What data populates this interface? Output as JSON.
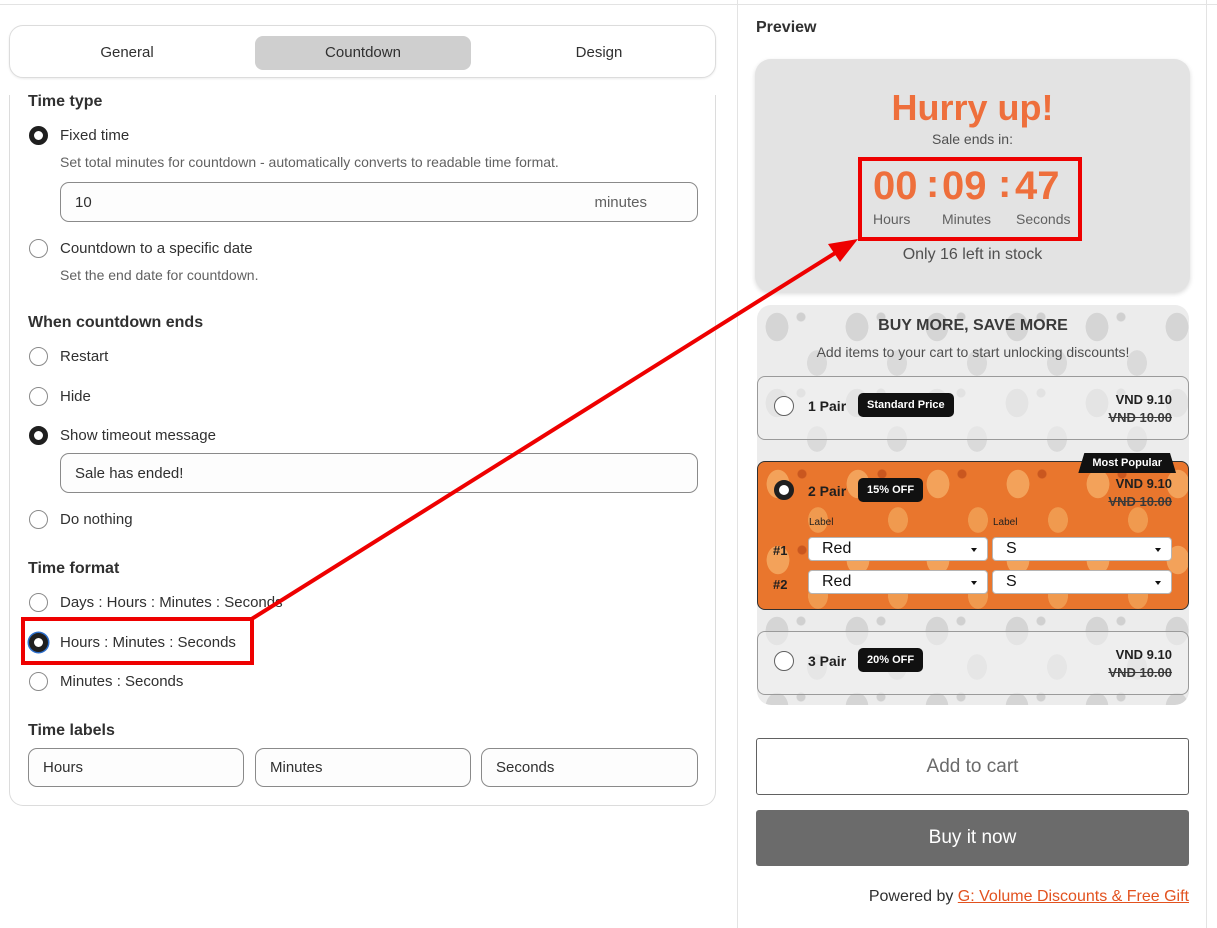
{
  "tabs": [
    {
      "label": "General",
      "active": false
    },
    {
      "label": "Countdown",
      "active": true
    },
    {
      "label": "Design",
      "active": false
    }
  ],
  "time_type": {
    "title": "Time type",
    "fixed_label": "Fixed time",
    "fixed_help": "Set total minutes for countdown - automatically converts to readable time format.",
    "minutes_value": "10",
    "minutes_suffix": "minutes",
    "specific_label": "Countdown to a specific date",
    "specific_help": "Set the end date for countdown."
  },
  "when_ends": {
    "title": "When countdown ends",
    "options": [
      "Restart",
      "Hide",
      "Show timeout message",
      "Do nothing"
    ],
    "selected": "Show timeout message",
    "timeout_message": "Sale has ended!"
  },
  "time_format": {
    "title": "Time format",
    "options": [
      "Days : Hours : Minutes : Seconds",
      "Hours : Minutes : Seconds",
      "Minutes : Seconds"
    ],
    "selected": "Hours : Minutes : Seconds"
  },
  "time_labels": {
    "title": "Time labels",
    "values": [
      "Hours",
      "Minutes",
      "Seconds"
    ]
  },
  "preview": {
    "label": "Preview",
    "headline": "Hurry up!",
    "subtitle": "Sale ends in:",
    "hours": "00",
    "minutes": "09",
    "seconds": "47",
    "separator": ":",
    "unit_hours": "Hours",
    "unit_minutes": "Minutes",
    "unit_seconds": "Seconds",
    "stock": "Only 16 left in stock",
    "accent_color": "#ee6f3c"
  },
  "bundle": {
    "title": "BUY MORE, SAVE MORE",
    "subtitle": "Add items to your cart to start unlocking discounts!",
    "offers": [
      {
        "name": "1 Pair",
        "badge": "Standard Price",
        "price": "VND 9.10",
        "old_price": "VND 10.00"
      },
      {
        "name": "2 Pair",
        "badge": "15% OFF",
        "price": "VND 9.10",
        "old_price": "VND 10.00",
        "ribbon": "Most Popular",
        "selected": true
      },
      {
        "name": "3 Pair",
        "badge": "20% OFF",
        "price": "VND 9.10",
        "old_price": "VND 10.00"
      }
    ],
    "variant_label": "Label",
    "variants": [
      {
        "num": "#1",
        "color": "Red",
        "size": "S"
      },
      {
        "num": "#2",
        "color": "Red",
        "size": "S"
      }
    ]
  },
  "buttons": {
    "add_to_cart": "Add to cart",
    "buy_now": "Buy it now"
  },
  "footer": {
    "powered_prefix": "Powered by",
    "powered_link": "G: Volume Discounts & Free Gift"
  },
  "annotation": {
    "highlight_color": "#ee0000"
  }
}
